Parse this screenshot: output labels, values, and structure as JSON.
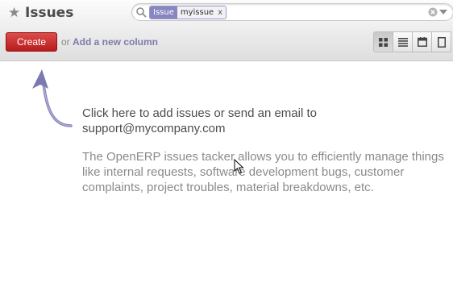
{
  "header": {
    "title": "Issues",
    "star_icon": "star-icon"
  },
  "search": {
    "facet_category": "Issue",
    "facet_value": "myissue",
    "facet_remove": "x",
    "icons": [
      "search-icon",
      "clear-icon",
      "dropdown-icon"
    ]
  },
  "toolbar": {
    "create_label": "Create",
    "or_text": "or",
    "add_column_label": "Add a new column",
    "views": [
      "kanban-view-icon",
      "list-view-icon",
      "calendar-view-icon",
      "form-view-icon"
    ],
    "active_view": "kanban-view-icon"
  },
  "help": {
    "main": "Click here to add issues or send an email to support@mycompany.com",
    "description": "The OpenERP issues tacker allows you to efficiently manage things like internal requests, software development bugs, customer complaints, project troubles, material breakdowns, etc."
  },
  "colors": {
    "create_button": "#c42b2b",
    "facet_category": "#8786c1",
    "link": "#7c7bad",
    "arrow": "#7b7aaf"
  }
}
